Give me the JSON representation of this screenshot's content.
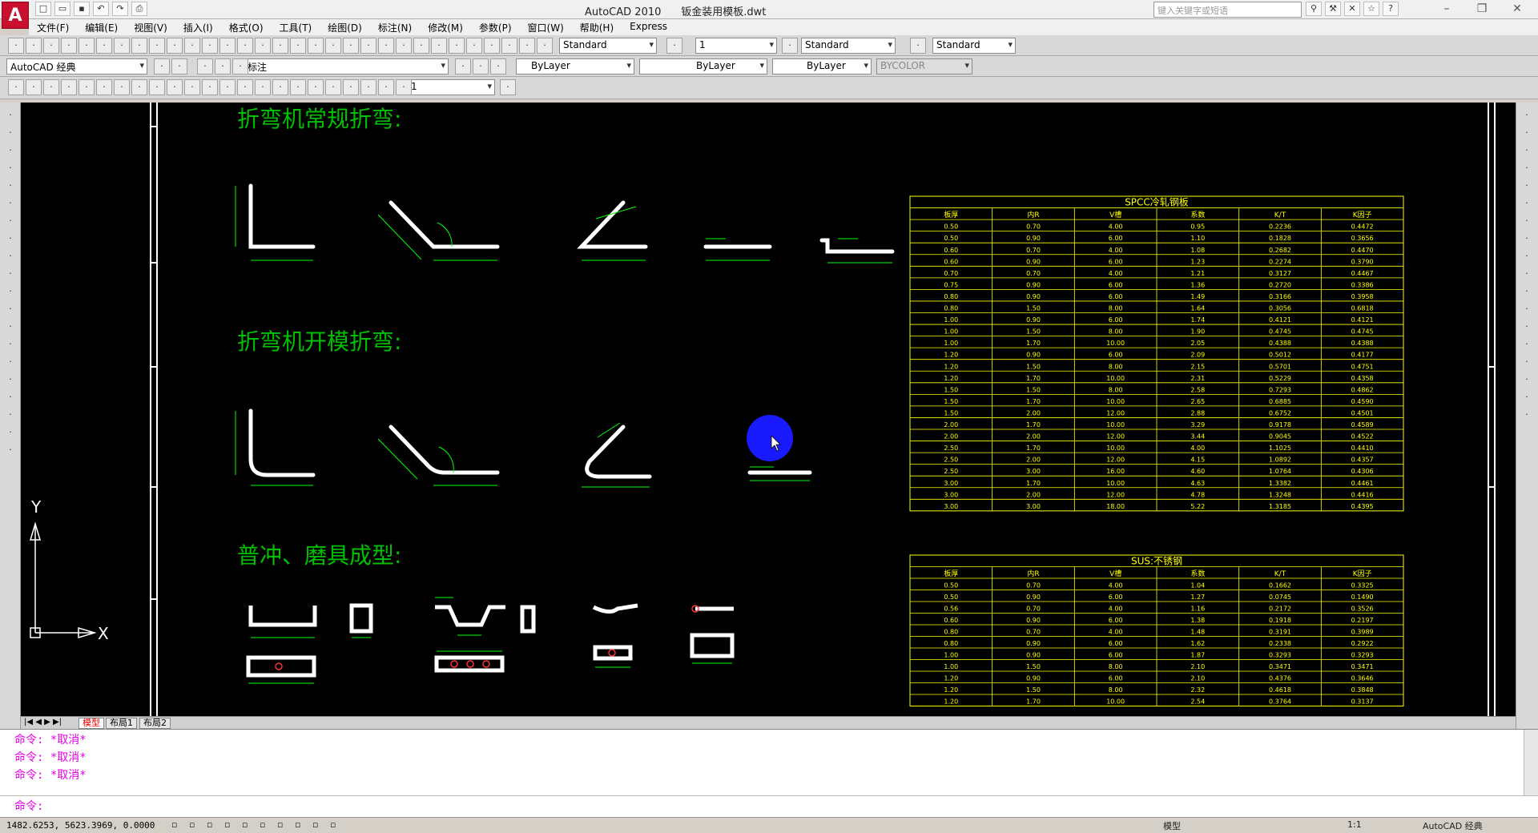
{
  "window": {
    "app_name": "AutoCAD 2010",
    "file_name": "钣金装用模板.dwt",
    "search_placeholder": "键入关键字或短语"
  },
  "app_logo": "A",
  "menu": [
    "文件(F)",
    "编辑(E)",
    "视图(V)",
    "插入(I)",
    "格式(O)",
    "工具(T)",
    "绘图(D)",
    "标注(N)",
    "修改(M)",
    "参数(P)",
    "窗口(W)",
    "帮助(H)",
    "Express"
  ],
  "toolbar1": {
    "text_style": "Standard",
    "dim_scale": "1",
    "dim_style": "Standard",
    "table_style": "Standard"
  },
  "toolbar2": {
    "workspace": "AutoCAD 经典",
    "layer": "标注",
    "color": "ByLayer",
    "linetype": "ByLayer",
    "lineweight": "ByLayer",
    "plotstyle": "BYCOLOR"
  },
  "toolbar3": {
    "dim_value": "1"
  },
  "drawing": {
    "heading1": "折弯机常规折弯:",
    "heading2": "折弯机开模折弯:",
    "heading3": "普冲、磨具成型:",
    "ucs_y": "Y",
    "ucs_x": "X",
    "colors": {
      "heading": "#00c000",
      "table": "#ffff00",
      "shape": "#ffffff",
      "dim": "#00ff00",
      "cursor": "#1a1aff"
    }
  },
  "table1": {
    "title": "SPCC冷轧钢板",
    "headers": [
      "板厚",
      "内R",
      "V槽",
      "系数",
      "K/T",
      "K因子"
    ],
    "rows": [
      [
        "0.50",
        "0.70",
        "4.00",
        "0.95",
        "0.2236",
        "0.4472"
      ],
      [
        "0.50",
        "0.90",
        "6.00",
        "1.10",
        "0.1828",
        "0.3656"
      ],
      [
        "0.60",
        "0.70",
        "4.00",
        "1.08",
        "0.2682",
        "0.4470"
      ],
      [
        "0.60",
        "0.90",
        "6.00",
        "1.23",
        "0.2274",
        "0.3790"
      ],
      [
        "0.70",
        "0.70",
        "4.00",
        "1.21",
        "0.3127",
        "0.4467"
      ],
      [
        "0.75",
        "0.90",
        "6.00",
        "1.36",
        "0.2720",
        "0.3386"
      ],
      [
        "0.80",
        "0.90",
        "6.00",
        "1.49",
        "0.3166",
        "0.3958"
      ],
      [
        "0.80",
        "1.50",
        "8.00",
        "1.64",
        "0.3056",
        "0.6818"
      ],
      [
        "1.00",
        "0.90",
        "6.00",
        "1.74",
        "0.4121",
        "0.4121"
      ],
      [
        "1.00",
        "1.50",
        "8.00",
        "1.90",
        "0.4745",
        "0.4745"
      ],
      [
        "1.00",
        "1.70",
        "10.00",
        "2.05",
        "0.4388",
        "0.4388"
      ],
      [
        "1.20",
        "0.90",
        "6.00",
        "2.09",
        "0.5012",
        "0.4177"
      ],
      [
        "1.20",
        "1.50",
        "8.00",
        "2.15",
        "0.5701",
        "0.4751"
      ],
      [
        "1.20",
        "1.70",
        "10.00",
        "2.31",
        "0.5229",
        "0.4358"
      ],
      [
        "1.50",
        "1.50",
        "8.00",
        "2.58",
        "0.7293",
        "0.4862"
      ],
      [
        "1.50",
        "1.70",
        "10.00",
        "2.65",
        "0.6885",
        "0.4590"
      ],
      [
        "1.50",
        "2.00",
        "12.00",
        "2.88",
        "0.6752",
        "0.4501"
      ],
      [
        "2.00",
        "1.70",
        "10.00",
        "3.29",
        "0.9178",
        "0.4589"
      ],
      [
        "2.00",
        "2.00",
        "12.00",
        "3.44",
        "0.9045",
        "0.4522"
      ],
      [
        "2.50",
        "1.70",
        "10.00",
        "4.00",
        "1.1025",
        "0.4410"
      ],
      [
        "2.50",
        "2.00",
        "12.00",
        "4.15",
        "1.0892",
        "0.4357"
      ],
      [
        "2.50",
        "3.00",
        "16.00",
        "4.60",
        "1.0764",
        "0.4306"
      ],
      [
        "3.00",
        "1.70",
        "10.00",
        "4.63",
        "1.3382",
        "0.4461"
      ],
      [
        "3.00",
        "2.00",
        "12.00",
        "4.78",
        "1.3248",
        "0.4416"
      ],
      [
        "3.00",
        "3.00",
        "18.00",
        "5.22",
        "1.3185",
        "0.4395"
      ]
    ]
  },
  "table2": {
    "title": "SUS:不锈钢",
    "headers": [
      "板厚",
      "内R",
      "V槽",
      "系数",
      "K/T",
      "K因子"
    ],
    "rows": [
      [
        "0.50",
        "0.70",
        "4.00",
        "1.04",
        "0.1662",
        "0.3325"
      ],
      [
        "0.50",
        "0.90",
        "6.00",
        "1.27",
        "0.0745",
        "0.1490"
      ],
      [
        "0.56",
        "0.70",
        "4.00",
        "1.16",
        "0.2172",
        "0.3526"
      ],
      [
        "0.60",
        "0.90",
        "6.00",
        "1.38",
        "0.1918",
        "0.2197"
      ],
      [
        "0.80",
        "0.70",
        "4.00",
        "1.48",
        "0.3191",
        "0.3989"
      ],
      [
        "0.80",
        "0.90",
        "6.00",
        "1.62",
        "0.2338",
        "0.2922"
      ],
      [
        "1.00",
        "0.90",
        "6.00",
        "1.87",
        "0.3293",
        "0.3293"
      ],
      [
        "1.00",
        "1.50",
        "8.00",
        "2.10",
        "0.3471",
        "0.3471"
      ],
      [
        "1.20",
        "0.90",
        "6.00",
        "2.10",
        "0.4376",
        "0.3646"
      ],
      [
        "1.20",
        "1.50",
        "8.00",
        "2.32",
        "0.4618",
        "0.3848"
      ],
      [
        "1.20",
        "1.70",
        "10.00",
        "2.54",
        "0.3764",
        "0.3137"
      ]
    ]
  },
  "tabs": [
    "模型",
    "布局1",
    "布局2"
  ],
  "command": {
    "history": [
      "命令: *取消*",
      "命令: *取消*",
      "命令: *取消*"
    ],
    "prompt": "命令:"
  },
  "status": {
    "coords": "1482.6253, 5623.3969, 0.0000",
    "model_label": "模型",
    "annotation_scale": "1:1",
    "workspace": "AutoCAD 经典"
  }
}
